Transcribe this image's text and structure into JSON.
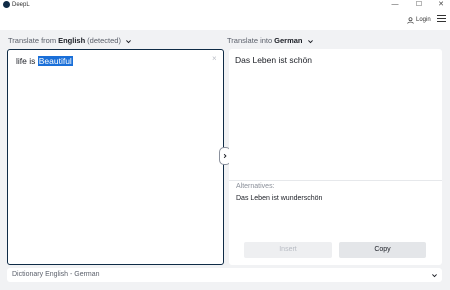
{
  "window": {
    "app_name": "DeepL",
    "minimize": "—",
    "maximize": "☐",
    "close": "✕"
  },
  "header": {
    "login_label": "Login"
  },
  "source": {
    "prefix": "Translate from",
    "language": "English",
    "suffix": "(detected)",
    "text_plain": "life is ",
    "text_selected": "Beautiful",
    "clear_symbol": "×"
  },
  "target": {
    "prefix": "Translate into",
    "language": "German",
    "text": "Das Leben ist schön",
    "alternatives_title": "Alternatives:",
    "alternatives": [
      "Das Leben ist wunderschön"
    ],
    "insert_label": "Insert",
    "copy_label": "Copy"
  },
  "dictionary": {
    "label": "Dictionary English - German"
  },
  "colors": {
    "accent": "#0f2b46",
    "selection": "#1a6fd8",
    "background": "#f1f2f4"
  },
  "icons": [
    "deepl-logo-icon",
    "user-icon",
    "hamburger-menu-icon",
    "chevron-down-icon",
    "chevron-right-icon",
    "close-icon"
  ]
}
